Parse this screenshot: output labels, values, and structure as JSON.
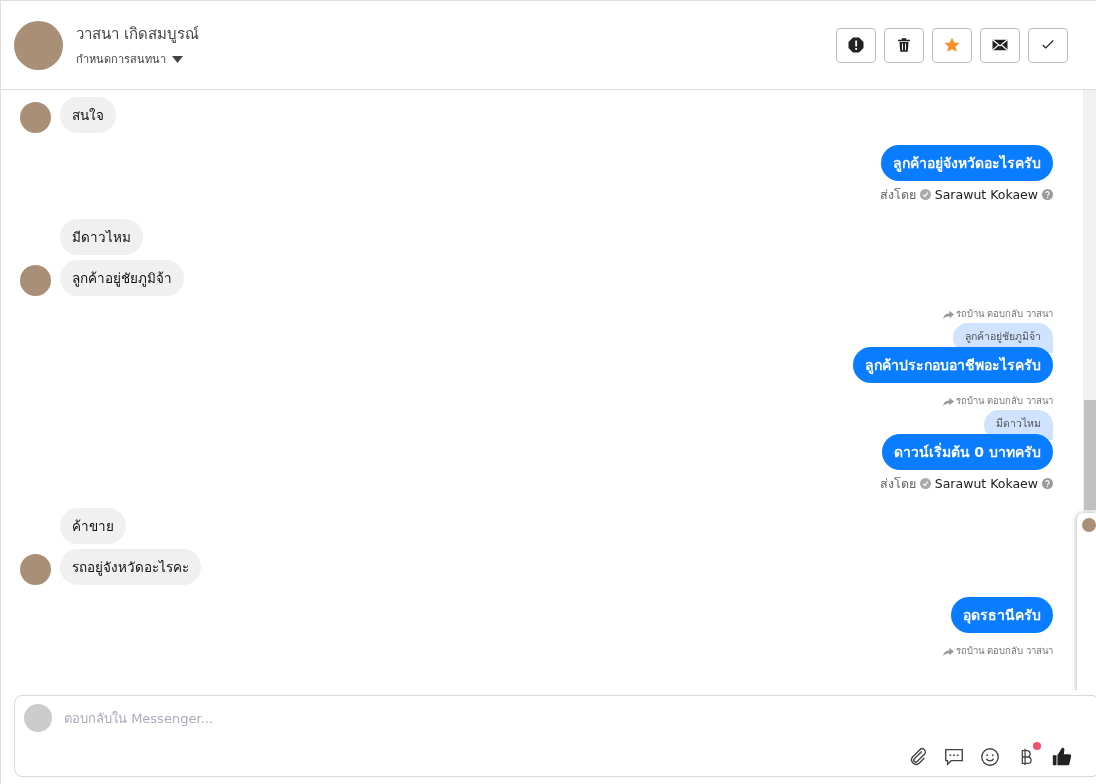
{
  "header": {
    "name": "วาสนา เกิดสมบูรณ์",
    "subtitle": "กำหนดการสนทนา",
    "actions": [
      {
        "kind": "alert",
        "active": false
      },
      {
        "kind": "trash",
        "active": false
      },
      {
        "kind": "star",
        "active": true
      },
      {
        "kind": "mail",
        "active": false
      },
      {
        "kind": "check",
        "active": false
      }
    ]
  },
  "messages": [
    {
      "kind": "in",
      "text": "สนใจ",
      "avatar": true
    },
    {
      "kind": "out",
      "text": "ลูกค้าอยู่จังหวัดอะไรครับ",
      "sent_label": "ส่งโดย",
      "sender": "Sarawut Kokaew"
    },
    {
      "kind": "in",
      "text": "มีดาวไหม",
      "avatar": false
    },
    {
      "kind": "in",
      "text": "ลูกค้าอยู่ชัยภูมิจ้า",
      "avatar": true
    },
    {
      "kind": "out",
      "reply_label": "รถบ้าน ตอบกลับ วาสนา",
      "quote": "ลูกค้าอยู่ชัยภูมิจ้า",
      "text": "ลูกค้าประกอบอาชีพอะไรครับ"
    },
    {
      "kind": "out",
      "reply_label": "รถบ้าน ตอบกลับ วาสนา",
      "quote": "มีดาวไหม",
      "text": "ดาวน์เริ่มต้น 0 บาทครับ",
      "sent_label": "ส่งโดย",
      "sender": "Sarawut Kokaew"
    },
    {
      "kind": "in",
      "text": "ค้าขาย",
      "avatar": false
    },
    {
      "kind": "in",
      "text": "รถอยู่จังหวัดอะไรคะ",
      "avatar": true
    },
    {
      "kind": "out",
      "text": "อุดรธานีครับ"
    },
    {
      "kind": "out",
      "reply_label": "รถบ้าน ตอบกลับ วาสนา"
    }
  ],
  "composer": {
    "placeholder": "ตอบกลับใน Messenger...",
    "tools": [
      {
        "kind": "attach",
        "badge": false
      },
      {
        "kind": "chat",
        "badge": false
      },
      {
        "kind": "emoji",
        "badge": false
      },
      {
        "kind": "baht",
        "badge": true
      },
      {
        "kind": "like",
        "badge": false
      }
    ]
  }
}
